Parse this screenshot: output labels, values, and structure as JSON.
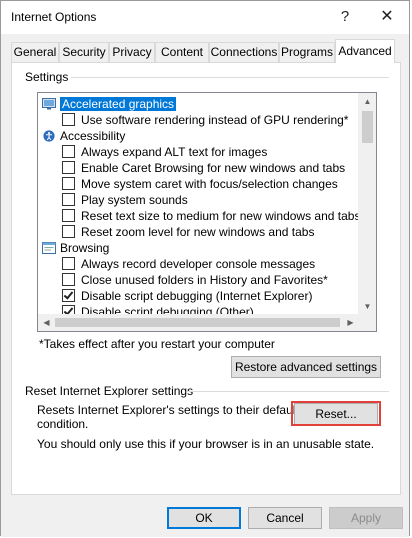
{
  "window": {
    "title": "Internet Options",
    "help_glyph": "?",
    "close_glyph": "✕"
  },
  "tabs": [
    {
      "label": "General"
    },
    {
      "label": "Security"
    },
    {
      "label": "Privacy"
    },
    {
      "label": "Content"
    },
    {
      "label": "Connections"
    },
    {
      "label": "Programs"
    },
    {
      "label": "Advanced",
      "active": true
    }
  ],
  "settings": {
    "group_label": "Settings",
    "items": [
      {
        "type": "folder",
        "label": "Accelerated graphics",
        "icon": "monitor-icon",
        "selected": true
      },
      {
        "type": "checkbox",
        "label": "Use software rendering instead of GPU rendering*",
        "checked": false
      },
      {
        "type": "folder",
        "label": "Accessibility",
        "icon": "accessibility-icon"
      },
      {
        "type": "checkbox",
        "label": "Always expand ALT text for images",
        "checked": false
      },
      {
        "type": "checkbox",
        "label": "Enable Caret Browsing for new windows and tabs",
        "checked": false
      },
      {
        "type": "checkbox",
        "label": "Move system caret with focus/selection changes",
        "checked": false
      },
      {
        "type": "checkbox",
        "label": "Play system sounds",
        "checked": false
      },
      {
        "type": "checkbox",
        "label": "Reset text size to medium for new windows and tabs",
        "checked": false
      },
      {
        "type": "checkbox",
        "label": "Reset zoom level for new windows and tabs",
        "checked": false
      },
      {
        "type": "folder",
        "label": "Browsing",
        "icon": "browser-window-icon"
      },
      {
        "type": "checkbox",
        "label": "Always record developer console messages",
        "checked": false
      },
      {
        "type": "checkbox",
        "label": "Close unused folders in History and Favorites*",
        "checked": false
      },
      {
        "type": "checkbox",
        "label": "Disable script debugging (Internet Explorer)",
        "checked": true
      },
      {
        "type": "checkbox",
        "label": "Disable script debugging (Other)",
        "checked": true
      }
    ],
    "note": "*Takes effect after you restart your computer",
    "restore_button": "Restore advanced settings"
  },
  "reset_section": {
    "group_label": "Reset Internet Explorer settings",
    "description_line1": "Resets Internet Explorer's settings to their default",
    "description_line2": "condition.",
    "warning": "You should only use this if your browser is in an unusable state.",
    "reset_button": "Reset...",
    "highlight_color": "#e0413b"
  },
  "footer": {
    "ok": "OK",
    "cancel": "Cancel",
    "apply": "Apply"
  },
  "colors": {
    "selection": "#0078d7",
    "dialog_bg": "#f0f0f0"
  }
}
